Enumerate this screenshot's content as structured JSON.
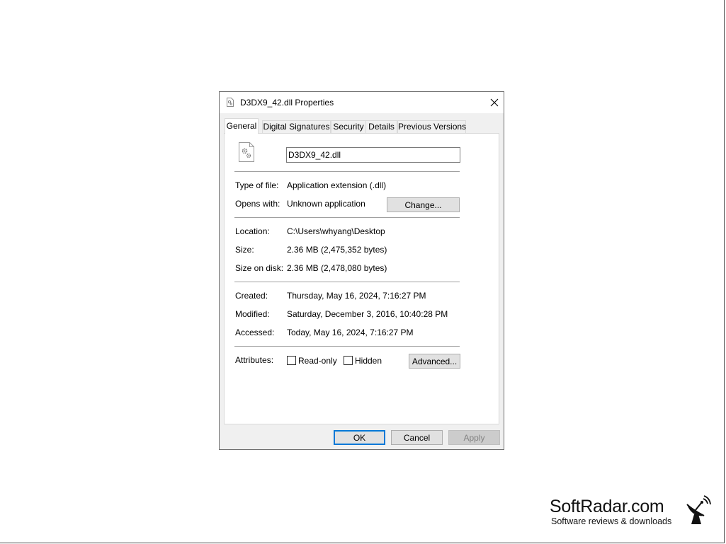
{
  "window": {
    "title": "D3DX9_42.dll Properties",
    "close_glyph": "✕"
  },
  "tabs": [
    {
      "label": "General",
      "active": true
    },
    {
      "label": "Digital Signatures",
      "active": false
    },
    {
      "label": "Security",
      "active": false
    },
    {
      "label": "Details",
      "active": false
    },
    {
      "label": "Previous Versions",
      "active": false
    }
  ],
  "general": {
    "file_icon": "dll-gear-file-icon",
    "file_name": "D3DX9_42.dll",
    "type_label": "Type of file:",
    "type_value": "Application extension (.dll)",
    "opens_label": "Opens with:",
    "opens_value": "Unknown application",
    "change_button": "Change...",
    "location_label": "Location:",
    "location_value": "C:\\Users\\whyang\\Desktop",
    "size_label": "Size:",
    "size_value": "2.36 MB (2,475,352 bytes)",
    "size_disk_label": "Size on disk:",
    "size_disk_value": "2.36 MB (2,478,080 bytes)",
    "created_label": "Created:",
    "created_value": "Thursday, May 16, 2024, 7:16:27 PM",
    "modified_label": "Modified:",
    "modified_value": "Saturday, December 3, 2016, 10:40:28 PM",
    "accessed_label": "Accessed:",
    "accessed_value": "Today, May 16, 2024, 7:16:27 PM",
    "attributes_label": "Attributes:",
    "readonly_label": "Read-only",
    "readonly_checked": false,
    "hidden_label": "Hidden",
    "hidden_checked": false,
    "advanced_button": "Advanced..."
  },
  "footer": {
    "ok": "OK",
    "cancel": "Cancel",
    "apply": "Apply"
  },
  "watermark": {
    "name": "SoftRadar.com",
    "tagline": "Software reviews & downloads",
    "icon": "radar-dish-icon"
  },
  "colors": {
    "accent": "#0078d7",
    "dialog_bg": "#f0f0f0",
    "button_bg": "#e1e1e1"
  }
}
